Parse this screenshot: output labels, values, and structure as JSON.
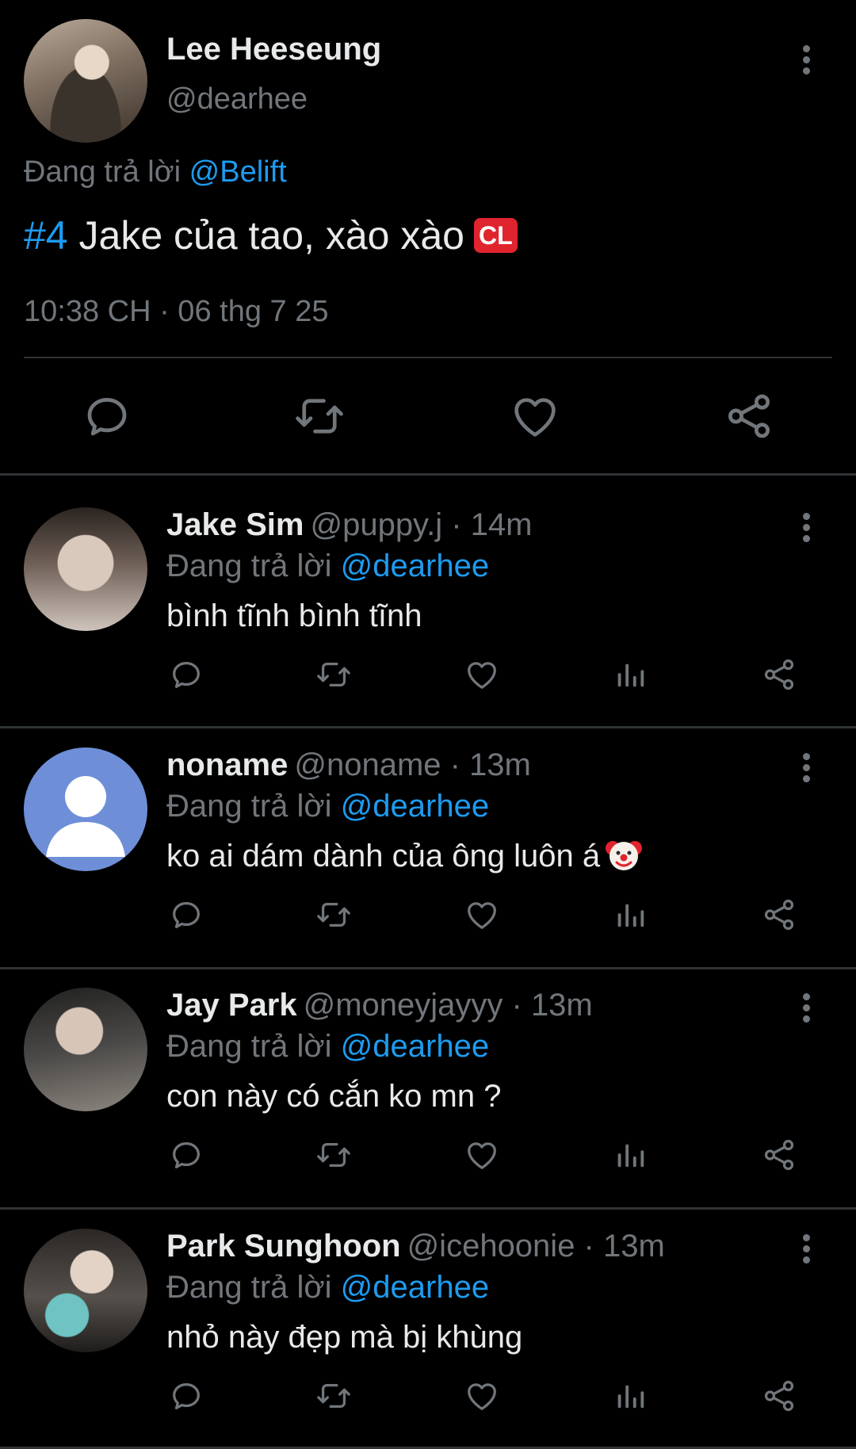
{
  "main_tweet": {
    "name": "Lee Heeseung",
    "handle": "@dearhee",
    "replying_prefix": "Đang trả lời",
    "replying_to": "@Belift",
    "hashtag": "#4",
    "text": " Jake của tao, xào xào",
    "badge": "CL",
    "timestamp": "10:38 CH · 06 thg 7 25",
    "actions": [
      "reply-icon",
      "retweet-icon",
      "like-icon",
      "share-icon"
    ]
  },
  "replies": [
    {
      "name": "Jake Sim",
      "handle_time": "@puppy.j · 14m",
      "replying_prefix": "Đang trả lời",
      "replying_to": "@dearhee",
      "text": "bình tĩnh bình tĩnh"
    },
    {
      "name": "noname",
      "handle_time": "@noname · 13m",
      "replying_prefix": "Đang trả lời",
      "replying_to": "@dearhee",
      "text": "ko ai dám dành của ông luôn á",
      "emoji": "clown-emoji"
    },
    {
      "name": "Jay Park",
      "handle_time": "@moneyjayyy · 13m",
      "replying_prefix": "Đang trả lời",
      "replying_to": "@dearhee",
      "text": "con này có cắn ko mn ?"
    },
    {
      "name": "Park Sunghoon",
      "handle_time": "@icehoonie · 13m",
      "replying_prefix": "Đang trả lời",
      "replying_to": "@dearhee",
      "text": "nhỏ này đẹp mà bị khùng"
    }
  ],
  "colors": {
    "background": "#000000",
    "text": "#e7e9ea",
    "muted": "#71767b",
    "link": "#1d9bf0",
    "separator": "#2f3336",
    "badge": "#e0242e"
  }
}
